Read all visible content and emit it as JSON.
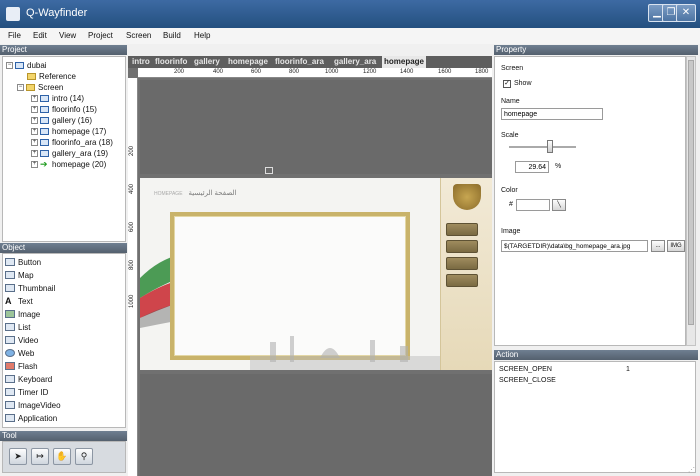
{
  "window": {
    "title": "Q-Wayfinder"
  },
  "menu": [
    "File",
    "Edit",
    "View",
    "Project",
    "Screen",
    "Build",
    "Help"
  ],
  "panels": {
    "project": "Project",
    "object": "Object",
    "tool": "Tool",
    "property": "Property",
    "action": "Action"
  },
  "project_tree": {
    "root": "dubai",
    "reference": "Reference",
    "screen": "Screen",
    "screens": [
      "intro (14)",
      "floorinfo (15)",
      "gallery (16)",
      "homepage (17)",
      "floorinfo_ara (18)",
      "gallery_ara (19)",
      "homepage (20)"
    ]
  },
  "objects": [
    "Button",
    "Map",
    "Thumbnail",
    "Text",
    "Image",
    "List",
    "Video",
    "Web",
    "Flash",
    "Keyboard",
    "Timer ID",
    "ImageVideo",
    "Application"
  ],
  "tabs": [
    "intro",
    "floorinfo",
    "gallery",
    "homepage",
    "floorinfo_ara",
    "gallery_ara",
    "homepage"
  ],
  "active_tab_index": 6,
  "ruler": {
    "h": [
      "200",
      "400",
      "600",
      "800",
      "1000",
      "1200",
      "1400",
      "1600",
      "1800"
    ],
    "v": [
      "200",
      "400",
      "600",
      "800",
      "1000"
    ]
  },
  "preview": {
    "breadcrumb_ar": "الصفحة الرئيسية",
    "breadcrumb_en": "HOMEPAGE"
  },
  "property": {
    "screen_label": "Screen",
    "show_label": "Show",
    "show_checked": "✓",
    "name_label": "Name",
    "name_value": "homepage",
    "scale_label": "Scale",
    "scale_value": "29.64",
    "scale_unit": "%",
    "color_label": "Color",
    "color_prefix": "#",
    "color_value": "",
    "image_label": "Image",
    "image_value": "$(TARGETDIR)\\data\\bg_homepage_ara.jpg",
    "browse_label": "...",
    "img_label": "IMG"
  },
  "actions": [
    {
      "name": "SCREEN_OPEN",
      "value": "1"
    },
    {
      "name": "SCREEN_CLOSE",
      "value": ""
    }
  ]
}
